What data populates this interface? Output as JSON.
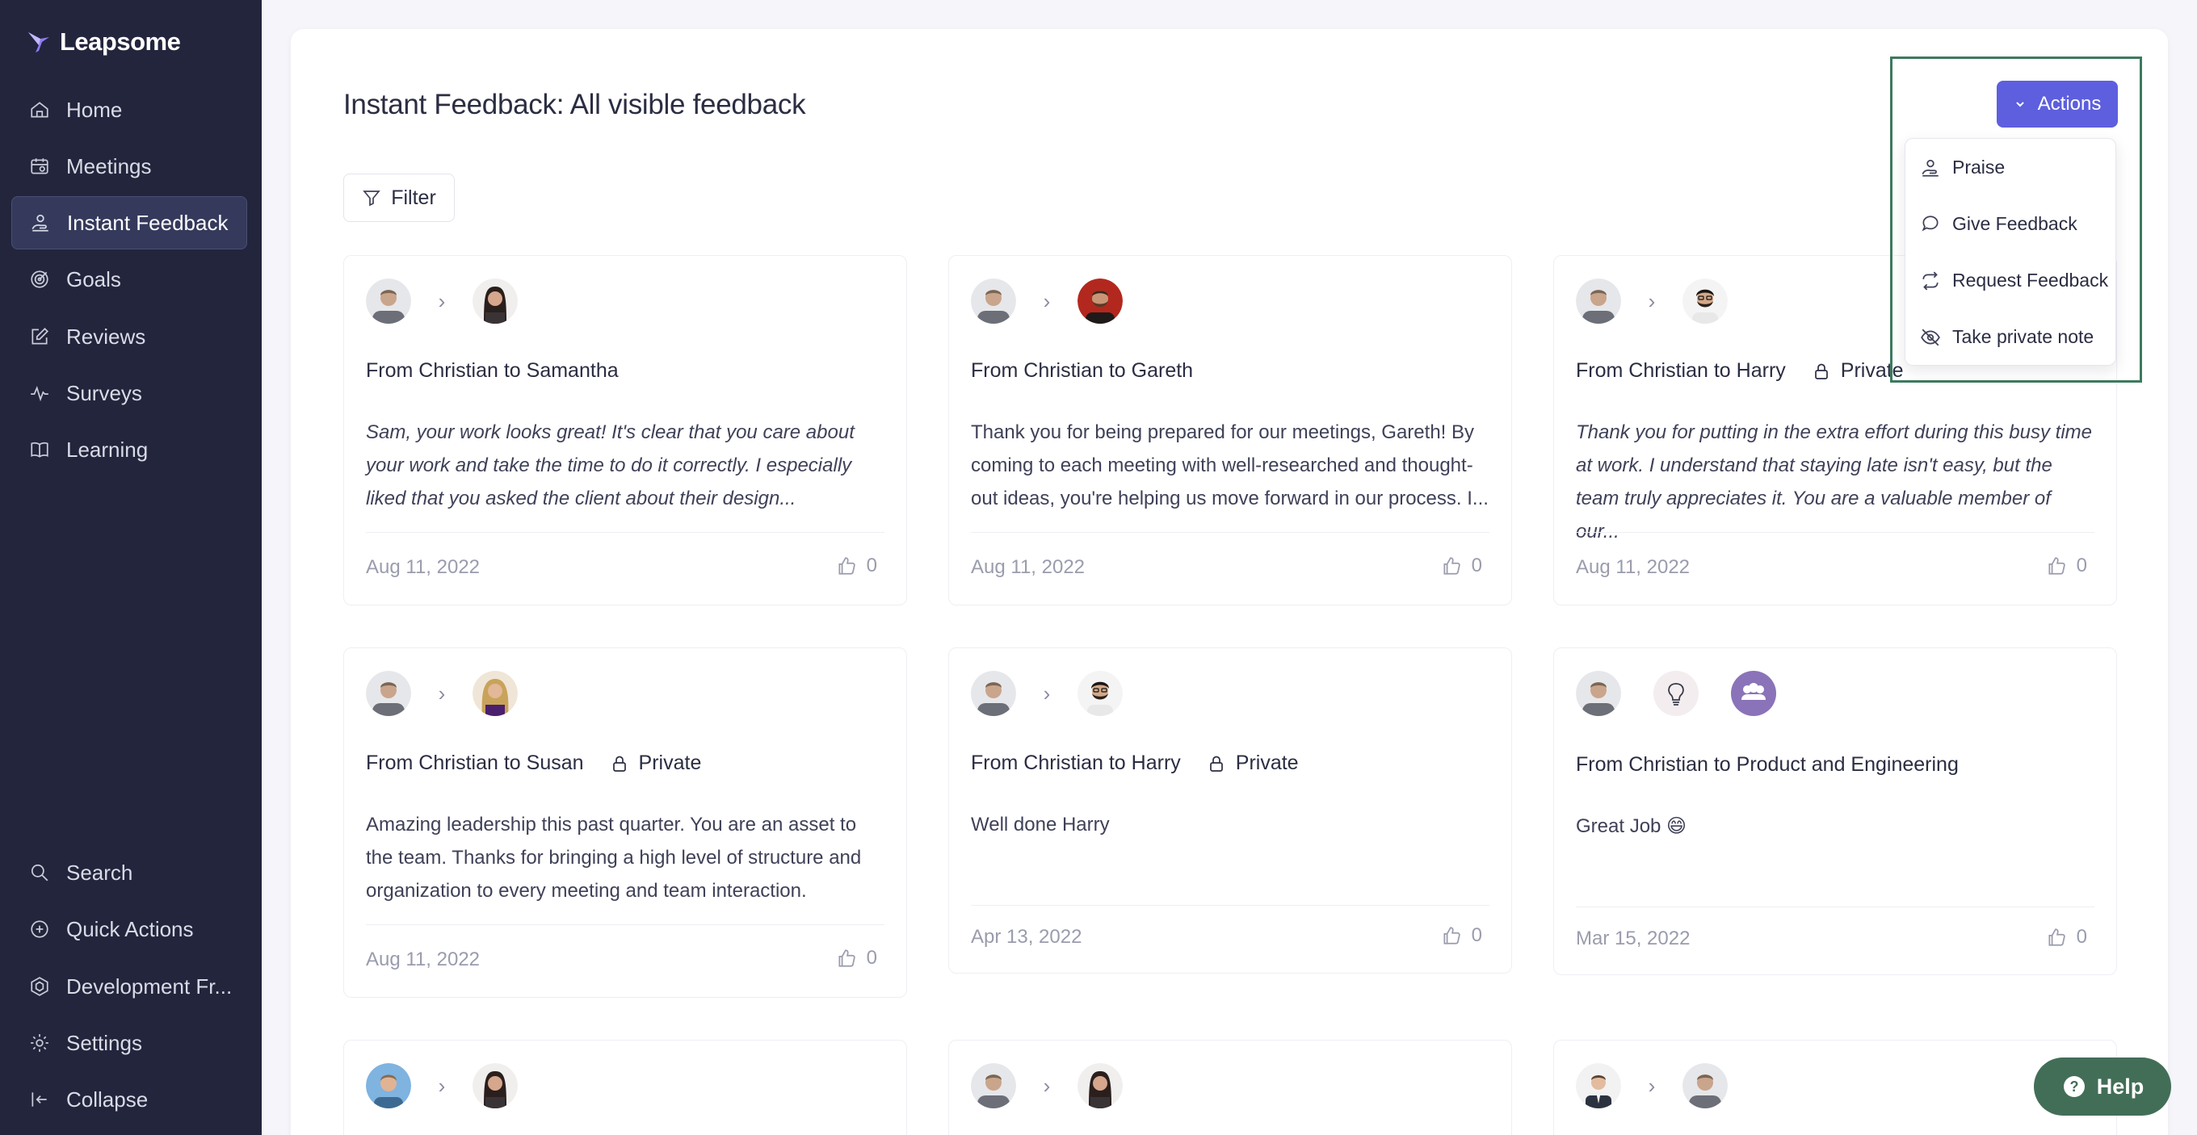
{
  "app": {
    "name": "Leapsome"
  },
  "sidebar": {
    "items": [
      {
        "label": "Home",
        "icon": "home-icon"
      },
      {
        "label": "Meetings",
        "icon": "meetings-icon"
      },
      {
        "label": "Instant Feedback",
        "icon": "feedback-icon",
        "active": true
      },
      {
        "label": "Goals",
        "icon": "goals-icon"
      },
      {
        "label": "Reviews",
        "icon": "reviews-icon"
      },
      {
        "label": "Surveys",
        "icon": "surveys-icon"
      },
      {
        "label": "Learning",
        "icon": "learning-icon"
      }
    ],
    "bottom_items": [
      {
        "label": "Search",
        "icon": "search-icon"
      },
      {
        "label": "Quick Actions",
        "icon": "plus-circle-icon"
      },
      {
        "label": "Development Fr...",
        "icon": "development-icon"
      },
      {
        "label": "Settings",
        "icon": "gear-icon"
      },
      {
        "label": "Collapse",
        "icon": "collapse-icon"
      }
    ]
  },
  "page": {
    "title": "Instant Feedback: All visible feedback",
    "filter_label": "Filter"
  },
  "actions": {
    "label": "Actions",
    "menu": [
      {
        "label": "Praise",
        "icon": "praise-icon"
      },
      {
        "label": "Give Feedback",
        "icon": "speech-bubble-icon"
      },
      {
        "label": "Request Feedback",
        "icon": "request-icon"
      },
      {
        "label": "Take private note",
        "icon": "eye-off-icon"
      }
    ]
  },
  "private_label": "Private",
  "cards": [
    {
      "heading": "From Christian to Samantha",
      "private": false,
      "italic": true,
      "body": "Sam, your work looks great! It's clear that you care about your work and take the time to do it correctly. I especially liked that you asked the client about their design...",
      "date": "Aug 11, 2022",
      "likes": "0"
    },
    {
      "heading": "From Christian to Gareth",
      "private": false,
      "italic": false,
      "body": "Thank you for being prepared for our meetings, Gareth! By coming to each meeting with well-researched and thought-out ideas, you're helping us move forward in our process. I...",
      "date": "Aug 11, 2022",
      "likes": "0"
    },
    {
      "heading": "From Christian to Harry",
      "private": true,
      "italic": true,
      "body": "Thank you for putting in the extra effort during this busy time at work. I understand that staying late isn't easy, but the team truly appreciates it. You are a valuable member of our...",
      "date": "Aug 11, 2022",
      "likes": "0"
    },
    {
      "heading": "From Christian to Susan",
      "private": true,
      "italic": false,
      "body": "Amazing leadership this past quarter. You are an asset to the team. Thanks for bringing a high level of structure and organization to every meeting and team interaction.",
      "date": "Aug 11, 2022",
      "likes": "0"
    },
    {
      "heading": "From Christian to Harry",
      "private": true,
      "italic": false,
      "body": "Well done Harry",
      "date": "Apr 13, 2022",
      "likes": "0"
    },
    {
      "heading": "From Christian to Product and Engineering",
      "private": false,
      "italic": false,
      "body": "Great Job 😄",
      "date": "Mar 15, 2022",
      "likes": "0"
    }
  ],
  "help": {
    "label": "Help"
  },
  "colors": {
    "sidebar_bg": "#23253d",
    "accent": "#5d5fde",
    "help_bg": "#426e57",
    "focus_outline": "#3d7a5e"
  }
}
